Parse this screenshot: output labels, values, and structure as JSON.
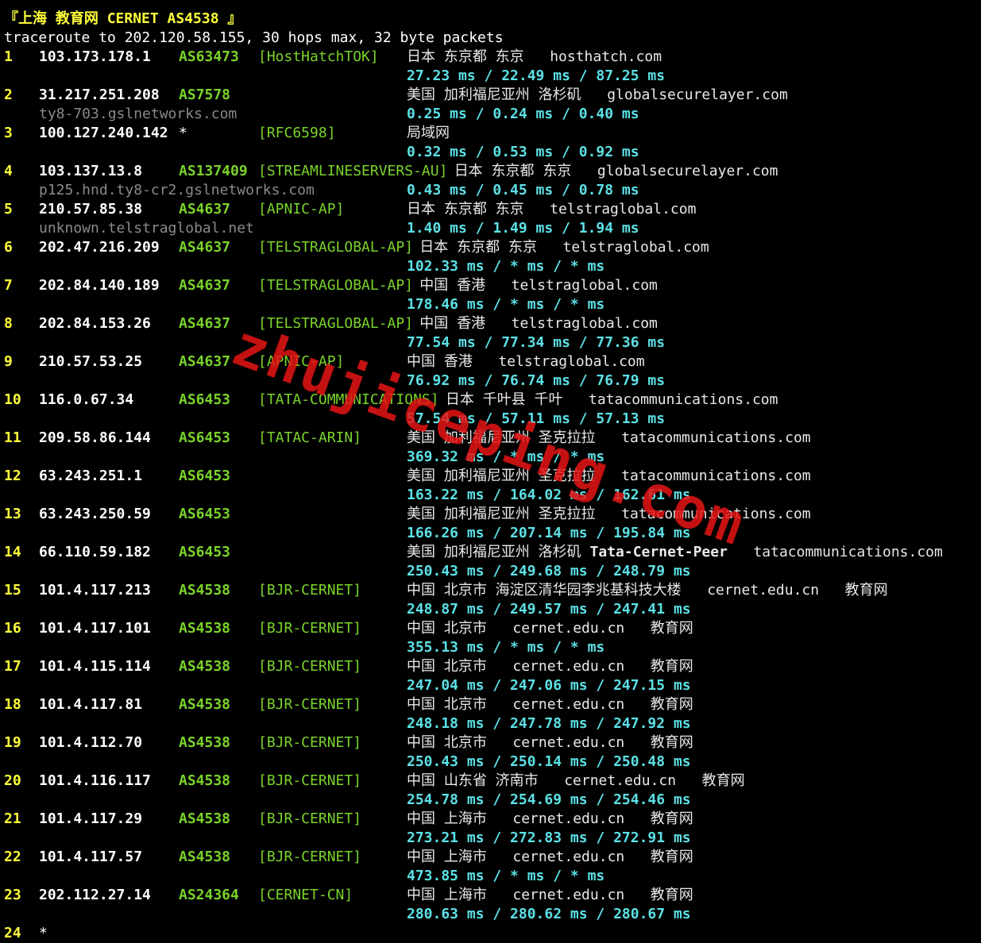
{
  "header": {
    "title_prefix": "『上海 教育网 ",
    "title_main": "CERNET AS4538",
    "title_suffix": " 』",
    "command": "traceroute to 202.120.58.155, 30 hops max, 32 byte packets"
  },
  "hops": [
    {
      "n": "1",
      "ip": "103.173.178.1",
      "asn": "AS63473",
      "tag": "[HostHatchTOK]",
      "geo": "日本 东京都 东京",
      "domain": "hosthatch.com",
      "extra": "",
      "geo2": "",
      "host": "",
      "rtt": "27.23 ms / 22.49 ms / 87.25 ms"
    },
    {
      "n": "2",
      "ip": "31.217.251.208",
      "asn": "AS7578",
      "tag": "",
      "geo": "美国 加利福尼亚州 洛杉矶",
      "domain": "globalsecurelayer.com",
      "extra": "",
      "geo2": "",
      "host": "ty8-703.gslnetworks.com",
      "rtt": "0.25 ms / 0.24 ms / 0.40 ms"
    },
    {
      "n": "3",
      "ip": "100.127.240.142",
      "asn": "*",
      "tag": "[RFC6598]",
      "geo": "局域网",
      "domain": "",
      "extra": "",
      "geo2": "",
      "host": "",
      "rtt": "0.32 ms / 0.53 ms / 0.92 ms"
    },
    {
      "n": "4",
      "ip": "103.137.13.8",
      "asn": "AS137409",
      "tag": "[STREAMLINESERVERS-AU]",
      "geo": "日本 东京都 东京",
      "domain": "globalsecurelayer.com",
      "extra": "",
      "geo2": "",
      "host": "p125.hnd.ty8-cr2.gslnetworks.com",
      "rtt": "0.43 ms / 0.45 ms / 0.78 ms"
    },
    {
      "n": "5",
      "ip": "210.57.85.38",
      "asn": "AS4637",
      "tag": "[APNIC-AP]",
      "geo": "日本 东京都 东京",
      "domain": "telstraglobal.com",
      "extra": "",
      "geo2": "",
      "host": "unknown.telstraglobal.net",
      "rtt": "1.40 ms / 1.49 ms / 1.94 ms"
    },
    {
      "n": "6",
      "ip": "202.47.216.209",
      "asn": "AS4637",
      "tag": "[TELSTRAGLOBAL-AP]",
      "geo": "日本 东京都 东京",
      "domain": "telstraglobal.com",
      "extra": "",
      "geo2": "",
      "host": "",
      "rtt": "102.33 ms / * ms / * ms"
    },
    {
      "n": "7",
      "ip": "202.84.140.189",
      "asn": "AS4637",
      "tag": "[TELSTRAGLOBAL-AP]",
      "geo": "中国 香港",
      "domain": "telstraglobal.com",
      "extra": "",
      "geo2": "",
      "host": "",
      "rtt": "178.46 ms / * ms / * ms"
    },
    {
      "n": "8",
      "ip": "202.84.153.26",
      "asn": "AS4637",
      "tag": "[TELSTRAGLOBAL-AP]",
      "geo": "中国 香港",
      "domain": "telstraglobal.com",
      "extra": "",
      "geo2": "",
      "host": "",
      "rtt": "77.54 ms / 77.34 ms / 77.36 ms"
    },
    {
      "n": "9",
      "ip": "210.57.53.25",
      "asn": "AS4637",
      "tag": "[APNIC-AP]",
      "geo": "中国 香港",
      "domain": "telstraglobal.com",
      "extra": "",
      "geo2": "",
      "host": "",
      "rtt": "76.92 ms / 76.74 ms / 76.79 ms"
    },
    {
      "n": "10",
      "ip": "116.0.67.34",
      "asn": "AS6453",
      "tag": "[TATA-COMMUNICATIONS]",
      "geo": "日本 千叶县 千叶",
      "domain": "tatacommunications.com",
      "extra": "",
      "geo2": "",
      "host": "",
      "rtt": "57.54 ms / 57.11 ms / 57.13 ms"
    },
    {
      "n": "11",
      "ip": "209.58.86.144",
      "asn": "AS6453",
      "tag": "[TATAC-ARIN]",
      "geo": "美国 加利福尼亚州 圣克拉拉",
      "domain": "tatacommunications.com",
      "extra": "",
      "geo2": "",
      "host": "",
      "rtt": "369.32 ms / * ms / * ms"
    },
    {
      "n": "12",
      "ip": "63.243.251.1",
      "asn": "AS6453",
      "tag": "",
      "geo": "美国 加利福尼亚州 圣克拉拉",
      "domain": "tatacommunications.com",
      "extra": "",
      "geo2": "",
      "host": "",
      "rtt": "163.22 ms / 164.02 ms / 162.61 ms"
    },
    {
      "n": "13",
      "ip": "63.243.250.59",
      "asn": "AS6453",
      "tag": "",
      "geo": "美国 加利福尼亚州 圣克拉拉",
      "domain": "tatacommunications.com",
      "extra": "",
      "geo2": "",
      "host": "",
      "rtt": "166.26 ms / 207.14 ms / 195.84 ms"
    },
    {
      "n": "14",
      "ip": "66.110.59.182",
      "asn": "AS6453",
      "tag": "",
      "geo": "美国 加利福尼亚州 洛杉矶",
      "domain": "tatacommunications.com",
      "extra": "Tata-Cernet-Peer",
      "geo2": "",
      "host": "",
      "rtt": "250.43 ms / 249.68 ms / 248.79 ms"
    },
    {
      "n": "15",
      "ip": "101.4.117.213",
      "asn": "AS4538",
      "tag": "[BJR-CERNET]",
      "geo": "中国 北京市 海淀区清华园李兆基科技大楼",
      "domain": "cernet.edu.cn",
      "extra": "",
      "geo2": "教育网",
      "host": "",
      "rtt": "248.87 ms / 249.57 ms / 247.41 ms"
    },
    {
      "n": "16",
      "ip": "101.4.117.101",
      "asn": "AS4538",
      "tag": "[BJR-CERNET]",
      "geo": "中国 北京市",
      "domain": "cernet.edu.cn",
      "extra": "",
      "geo2": "教育网",
      "host": "",
      "rtt": "355.13 ms / * ms / * ms"
    },
    {
      "n": "17",
      "ip": "101.4.115.114",
      "asn": "AS4538",
      "tag": "[BJR-CERNET]",
      "geo": "中国 北京市",
      "domain": "cernet.edu.cn",
      "extra": "",
      "geo2": "教育网",
      "host": "",
      "rtt": "247.04 ms / 247.06 ms / 247.15 ms"
    },
    {
      "n": "18",
      "ip": "101.4.117.81",
      "asn": "AS4538",
      "tag": "[BJR-CERNET]",
      "geo": "中国 北京市",
      "domain": "cernet.edu.cn",
      "extra": "",
      "geo2": "教育网",
      "host": "",
      "rtt": "248.18 ms / 247.78 ms / 247.92 ms"
    },
    {
      "n": "19",
      "ip": "101.4.112.70",
      "asn": "AS4538",
      "tag": "[BJR-CERNET]",
      "geo": "中国 北京市",
      "domain": "cernet.edu.cn",
      "extra": "",
      "geo2": "教育网",
      "host": "",
      "rtt": "250.43 ms / 250.14 ms / 250.48 ms"
    },
    {
      "n": "20",
      "ip": "101.4.116.117",
      "asn": "AS4538",
      "tag": "[BJR-CERNET]",
      "geo": "中国 山东省 济南市",
      "domain": "cernet.edu.cn",
      "extra": "",
      "geo2": "教育网",
      "host": "",
      "rtt": "254.78 ms / 254.69 ms / 254.46 ms"
    },
    {
      "n": "21",
      "ip": "101.4.117.29",
      "asn": "AS4538",
      "tag": "[BJR-CERNET]",
      "geo": "中国 上海市",
      "domain": "cernet.edu.cn",
      "extra": "",
      "geo2": "教育网",
      "host": "",
      "rtt": "273.21 ms / 272.83 ms / 272.91 ms"
    },
    {
      "n": "22",
      "ip": "101.4.117.57",
      "asn": "AS4538",
      "tag": "[BJR-CERNET]",
      "geo": "中国 上海市",
      "domain": "cernet.edu.cn",
      "extra": "",
      "geo2": "教育网",
      "host": "",
      "rtt": "473.85 ms / * ms / * ms"
    },
    {
      "n": "23",
      "ip": "202.112.27.14",
      "asn": "AS24364",
      "tag": "[CERNET-CN]",
      "geo": "中国 上海市",
      "domain": "cernet.edu.cn",
      "extra": "",
      "geo2": "教育网",
      "host": "",
      "rtt": "280.63 ms / 280.62 ms / 280.67 ms"
    }
  ],
  "trailing": {
    "n": "24",
    "asn": "*"
  },
  "watermark": "zhujiceping.com",
  "colors": {
    "background": "#000000",
    "hop_number": "#ffff3a",
    "asn": "#7ad32a",
    "rtt": "#5ce1e6",
    "hostname": "#8a8a8a",
    "watermark": "#e61414"
  }
}
